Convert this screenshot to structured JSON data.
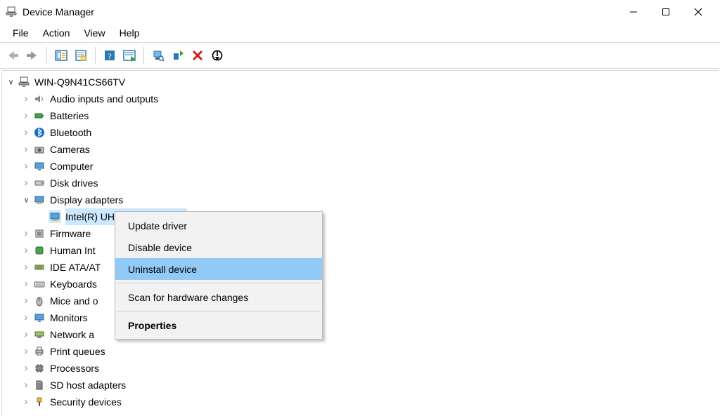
{
  "window": {
    "title": "Device Manager"
  },
  "menubar": {
    "file": "File",
    "action": "Action",
    "view": "View",
    "help": "Help"
  },
  "tree": {
    "root": "WIN-Q9N41CS66TV",
    "cat0": "Audio inputs and outputs",
    "cat1": "Batteries",
    "cat2": "Bluetooth",
    "cat3": "Cameras",
    "cat4": "Computer",
    "cat5": "Disk drives",
    "cat6": "Display adapters",
    "cat6_dev0": "Intel(R) UHD Graphics 600",
    "cat7": "Firmware",
    "cat8_full": "Human Interface Devices",
    "cat8": "Human Int",
    "cat9_full": "IDE ATA/ATAPI controllers",
    "cat9": "IDE ATA/AT",
    "cat10": "Keyboards",
    "cat11_full": "Mice and other pointing devices",
    "cat11": "Mice and o",
    "cat12": "Monitors",
    "cat13_full": "Network adapters",
    "cat13": "Network a",
    "cat14": "Print queues",
    "cat15": "Processors",
    "cat16": "SD host adapters",
    "cat17": "Security devices"
  },
  "context_menu": {
    "update": "Update driver",
    "disable": "Disable device",
    "uninstall": "Uninstall device",
    "scan": "Scan for hardware changes",
    "properties": "Properties"
  }
}
